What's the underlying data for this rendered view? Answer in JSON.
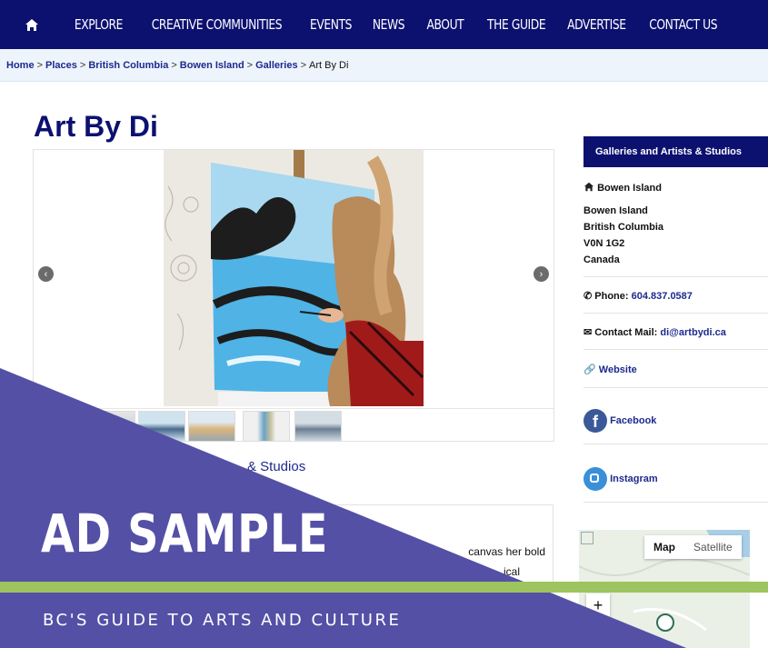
{
  "nav": {
    "home_icon": "home-icon",
    "items": [
      "EXPLORE",
      "CREATIVE COMMUNITIES",
      "EVENTS",
      "NEWS",
      "ABOUT",
      "THE GUIDE",
      "ADVERTISE",
      "CONTACT US"
    ]
  },
  "breadcrumb": {
    "links": [
      "Home",
      "Places",
      "British Columbia",
      "Bowen Island",
      "Galleries"
    ],
    "separator": ">",
    "current": "Art By Di"
  },
  "page": {
    "title": "Art By Di"
  },
  "gallery": {
    "prev_icon": "chevron-left-icon",
    "next_icon": "chevron-right-icon"
  },
  "category_link": "& Studios",
  "description_fragment_1": "canvas her bold",
  "description_fragment_2": "ical",
  "sidebar": {
    "header": "Galleries and Artists & Studios",
    "location_icon": "home-icon",
    "location": "Bowen Island",
    "address": [
      "Bowen Island",
      "British Columbia",
      "V0N 1G2",
      "Canada"
    ],
    "phone_label": "Phone:",
    "phone": "604.837.0587",
    "mail_label": "Contact Mail:",
    "mail": "di@artbydi.ca",
    "website": "Website",
    "facebook": "Facebook",
    "instagram": "Instagram"
  },
  "map": {
    "map_label": "Map",
    "satellite_label": "Satellite",
    "zoom_in": "+"
  },
  "ad": {
    "title": "AD SAMPLE",
    "subtitle": "BC'S GUIDE TO ARTS AND CULTURE",
    "colors": {
      "purple": "#5450a6",
      "green": "#9dc45f",
      "navy": "#0c1170"
    }
  }
}
